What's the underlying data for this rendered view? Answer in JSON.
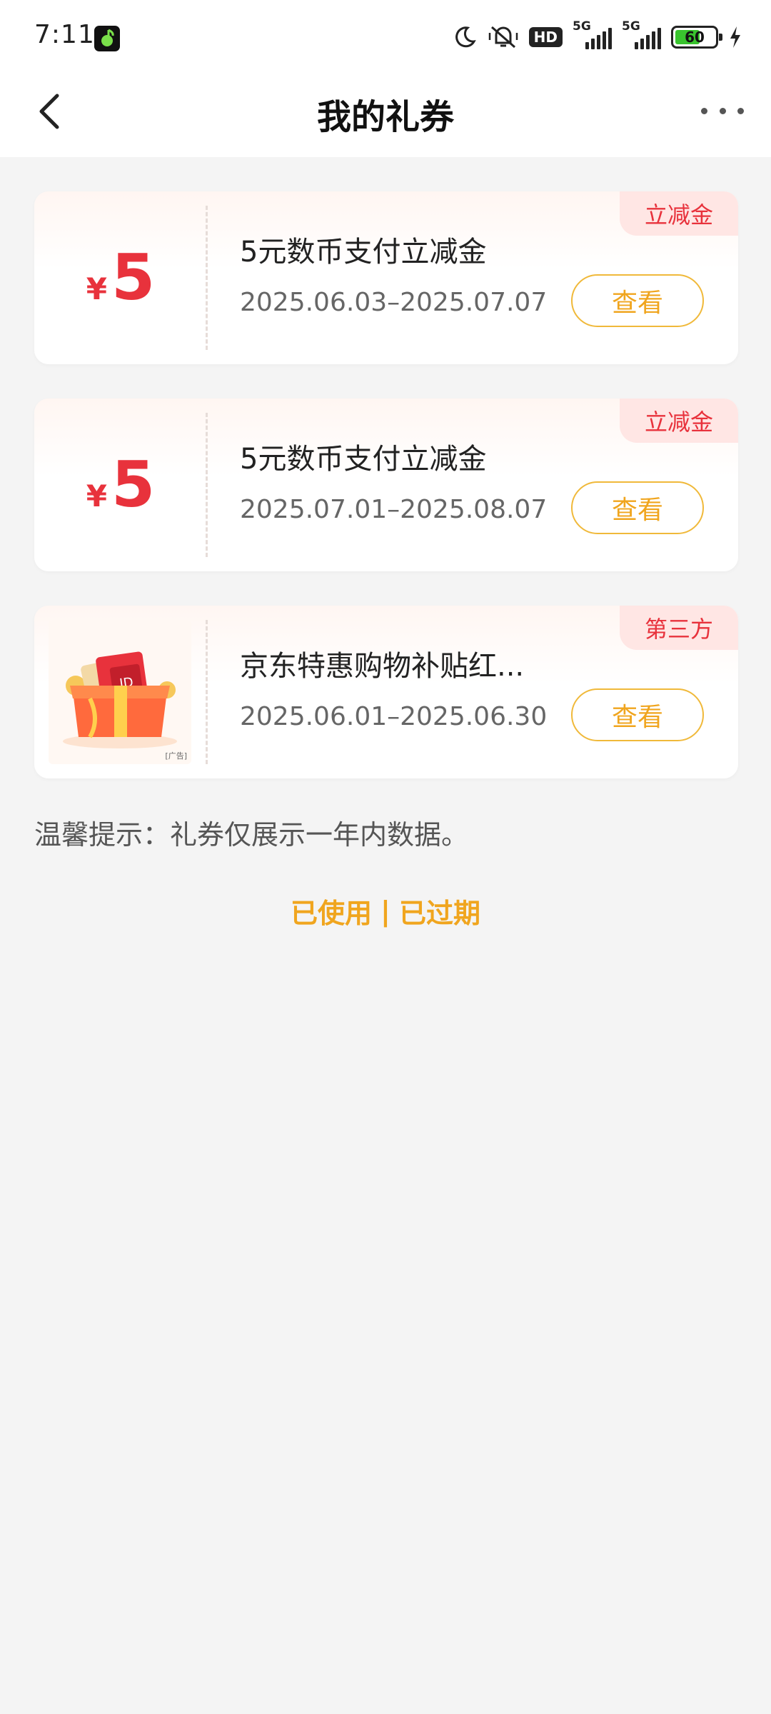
{
  "status_bar": {
    "time": "7:11",
    "battery_level": "60",
    "network_1": "5G",
    "network_2": "5G",
    "hd_label": "HD"
  },
  "header": {
    "title": "我的礼券"
  },
  "coupons": [
    {
      "currency": "¥",
      "amount": "5",
      "name": "5元数币支付立减金",
      "date_range": "2025.06.03–2025.07.07",
      "tag": "立减金",
      "action": "查看"
    },
    {
      "currency": "¥",
      "amount": "5",
      "name": "5元数币支付立减金",
      "date_range": "2025.07.01–2025.08.07",
      "tag": "立减金",
      "action": "查看"
    },
    {
      "image": "gift-box-red-envelope",
      "image_label": "[广告]",
      "name": "京东特惠购物补贴红...",
      "date_range": "2025.06.01–2025.06.30",
      "tag": "第三方",
      "action": "查看"
    }
  ],
  "tip": "温馨提示：礼券仅展示一年内数据。",
  "links": {
    "used": "已使用",
    "separator": "|",
    "expired": "已过期"
  },
  "colors": {
    "accent_red": "#e8323c",
    "accent_orange": "#f0a51e"
  }
}
